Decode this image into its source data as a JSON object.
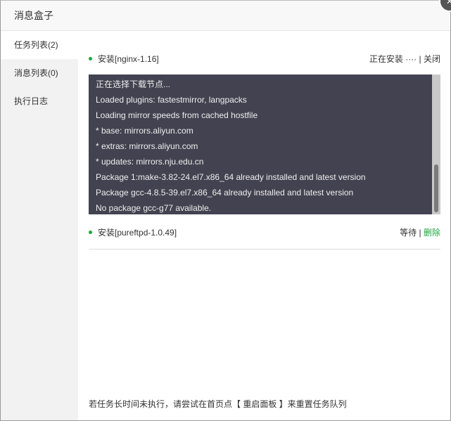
{
  "window": {
    "title": "消息盒子"
  },
  "sidebar": {
    "items": [
      {
        "label": "任务列表(2)"
      },
      {
        "label": "消息列表(0)"
      },
      {
        "label": "执行日志"
      }
    ]
  },
  "tasks": [
    {
      "name": "安装[nginx-1.16]",
      "status": "正在安装 ····",
      "action": "关闭"
    },
    {
      "name": "安装[pureftpd-1.0.49]",
      "status": "等待",
      "action": "删除"
    }
  ],
  "log": [
    "正在选择下载节点...",
    "Loaded plugins: fastestmirror, langpacks",
    "Loading mirror speeds from cached hostfile",
    "* base: mirrors.aliyun.com",
    "* extras: mirrors.aliyun.com",
    "* updates: mirrors.nju.edu.cn",
    "Package 1:make-3.82-24.el7.x86_64 already installed and latest version",
    "Package gcc-4.8.5-39.el7.x86_64 already installed and latest version",
    "No package gcc-g77 available."
  ],
  "footer": {
    "tip": "若任务长时间未执行，请尝试在首页点【 重启面板 】来重置任务队列"
  },
  "colors": {
    "accent": "#20a53a",
    "log_bg": "#434250"
  },
  "separator": " | ",
  "icons": {
    "close": "close-icon"
  }
}
